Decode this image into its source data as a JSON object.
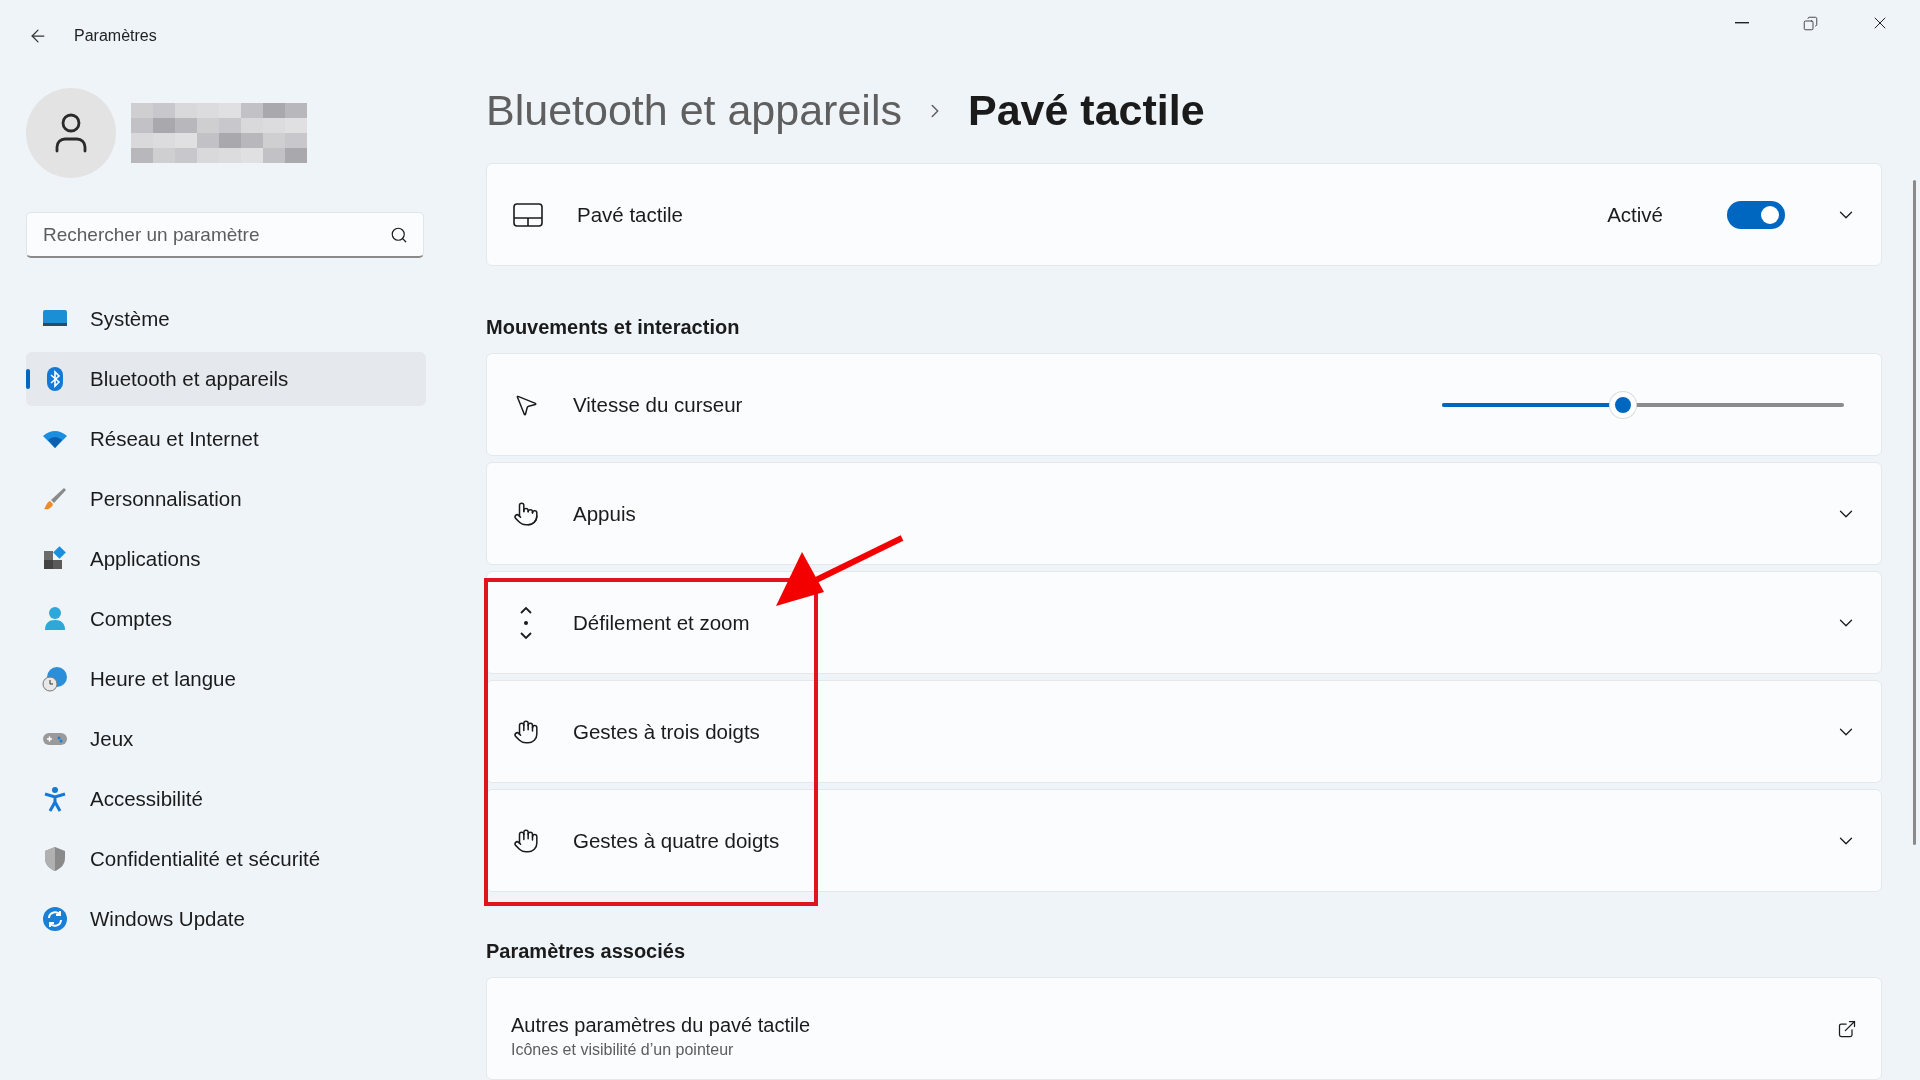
{
  "window": {
    "title": "Paramètres"
  },
  "search": {
    "placeholder": "Rechercher un paramètre"
  },
  "sidebar": {
    "items": [
      {
        "label": "Système",
        "selected": false
      },
      {
        "label": "Bluetooth et appareils",
        "selected": true
      },
      {
        "label": "Réseau et Internet",
        "selected": false
      },
      {
        "label": "Personnalisation",
        "selected": false
      },
      {
        "label": "Applications",
        "selected": false
      },
      {
        "label": "Comptes",
        "selected": false
      },
      {
        "label": "Heure et langue",
        "selected": false
      },
      {
        "label": "Jeux",
        "selected": false
      },
      {
        "label": "Accessibilité",
        "selected": false
      },
      {
        "label": "Confidentialité et sécurité",
        "selected": false
      },
      {
        "label": "Windows Update",
        "selected": false
      }
    ]
  },
  "breadcrumb": {
    "parent": "Bluetooth et appareils",
    "current": "Pavé tactile"
  },
  "touchpad_card": {
    "label": "Pavé tactile",
    "status": "Activé",
    "on": true,
    "expanded": false
  },
  "gestures": {
    "heading": "Mouvements et interaction",
    "rows": [
      {
        "kind": "slider",
        "label": "Vitesse du curseur",
        "level": 0.45
      },
      {
        "kind": "expander",
        "label": "Appuis",
        "expanded": false
      },
      {
        "kind": "expander",
        "label": "Défilement et zoom",
        "expanded": false
      },
      {
        "kind": "expander",
        "label": "Gestes à trois doigts",
        "expanded": false
      },
      {
        "kind": "expander",
        "label": "Gestes à quatre doigts",
        "expanded": false
      }
    ]
  },
  "related": {
    "heading": "Paramètres associés",
    "items": [
      {
        "title": "Autres paramètres du pavé tactile",
        "subtitle": "Icônes et visibilité d’un pointeur"
      }
    ]
  }
}
